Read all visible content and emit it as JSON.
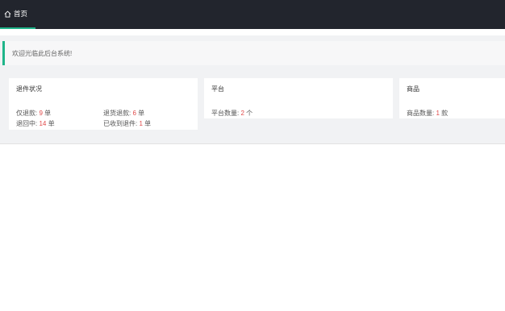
{
  "tabs": [
    {
      "label": "首页",
      "icon": "home-icon"
    }
  ],
  "notice": {
    "text": "欢迎光临此后台系统!"
  },
  "accent": "#1fb58a",
  "cards": {
    "returns": {
      "title": "退件状况",
      "stats": [
        {
          "label": "仅退款:",
          "value": "9",
          "unit": "单"
        },
        {
          "label": "退货退款:",
          "value": "6",
          "unit": "单"
        },
        {
          "label": "退回中:",
          "value": "14",
          "unit": "单"
        },
        {
          "label": "已收到退件:",
          "value": "1",
          "unit": "单"
        }
      ]
    },
    "platform": {
      "title": "平台",
      "stats": [
        {
          "label": "平台数量:",
          "value": "2",
          "unit": "个"
        }
      ]
    },
    "goods": {
      "title": "商品",
      "stats": [
        {
          "label": "商品数量:",
          "value": "1",
          "unit": "款"
        }
      ]
    }
  }
}
